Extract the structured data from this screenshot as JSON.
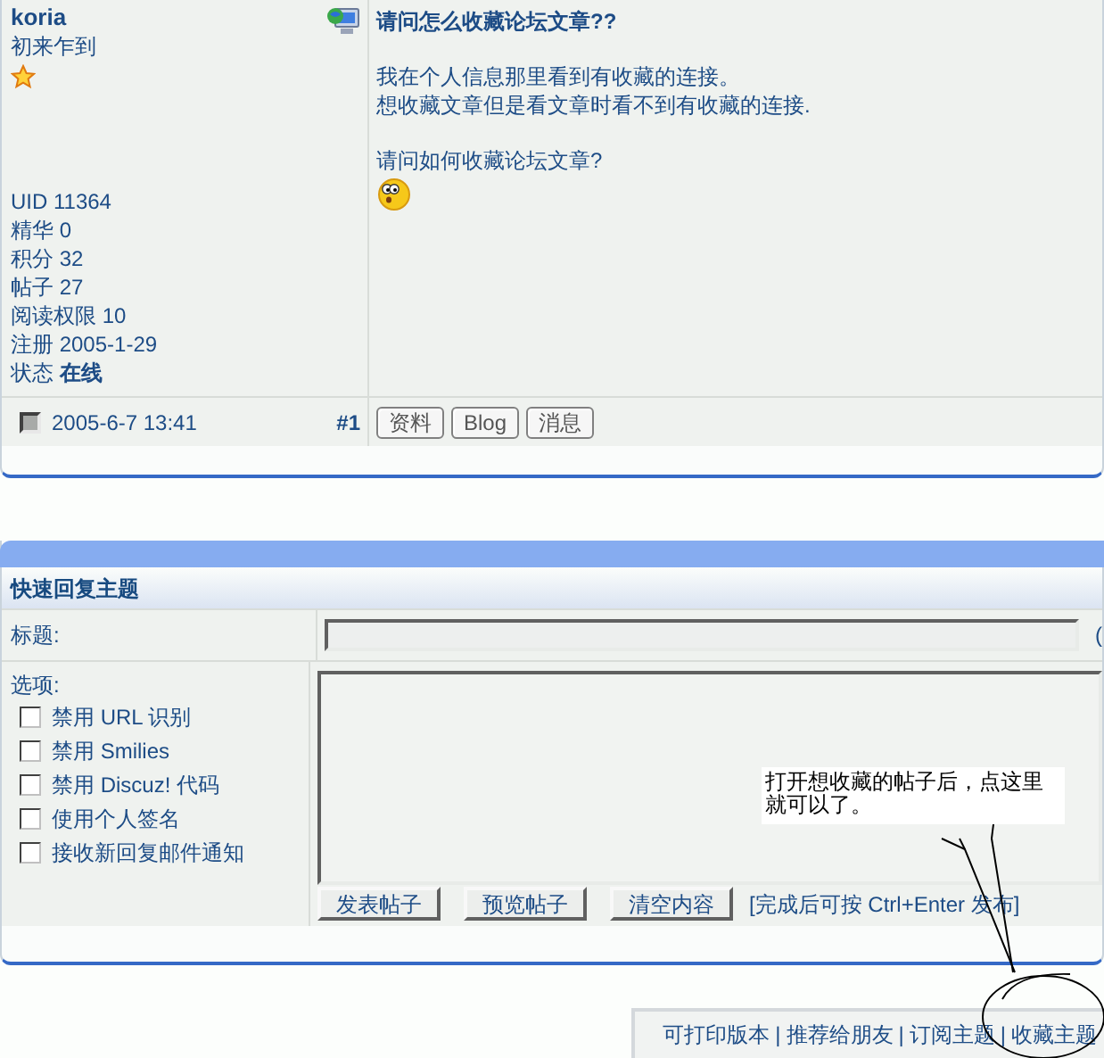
{
  "post": {
    "author": "koria",
    "rank": "初来乍到",
    "title": "请问怎么收藏论坛文章??",
    "paragraphs": [
      [
        "我在个人信息那里看到有收藏的连接。",
        "想收藏文章但是看文章时看不到有收藏的连接."
      ],
      [
        "请问如何收藏论坛文章?"
      ]
    ],
    "stats": [
      "UID 11364",
      "精华 0",
      "积分 32",
      "帖子 27",
      "阅读权限 10",
      "注册 2005-1-29",
      "状态 **在线**"
    ],
    "date": "2005-6-7 13:41",
    "floor": "#1",
    "buttons": [
      "资料",
      "Blog",
      "消息"
    ]
  },
  "reply": {
    "title": "快速回复主题",
    "subject_label": "标题:",
    "subject_suffix": "(",
    "options_label": "选项:",
    "options": [
      {
        "label": "禁用 URL 识别",
        "checked": false
      },
      {
        "label": "禁用 Smilies",
        "checked": false
      },
      {
        "label": "禁用 Discuz! 代码",
        "checked": false
      },
      {
        "label": "使用个人签名",
        "checked": false
      },
      {
        "label": "接收新回复邮件通知",
        "checked": false
      }
    ],
    "buttons": [
      "发表帖子",
      "预览帖子",
      "清空内容"
    ],
    "hint": "[完成后可按 Ctrl+Enter 发布]"
  },
  "annotation": {
    "lines": [
      "打开想收藏的帖子后，点这里",
      "就可以了。"
    ]
  },
  "footer_links": [
    "可打印版本",
    "推荐给朋友",
    "订阅主题",
    "收藏主题"
  ],
  "link_separator": "|"
}
